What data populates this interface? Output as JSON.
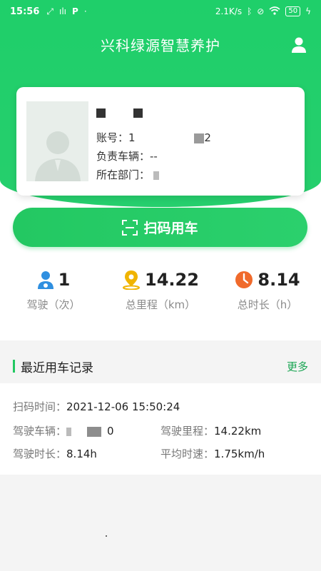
{
  "status_bar": {
    "time": "15:56",
    "net_speed": "2.1K/s",
    "battery": "50"
  },
  "header": {
    "title": "兴科绿源智慧养护"
  },
  "profile": {
    "name_masked": "",
    "account_label": "账号：",
    "account_value_start": "1",
    "account_value_end": "2",
    "vehicle_label": "负责车辆：",
    "vehicle_value": "--",
    "dept_label": "所在部门："
  },
  "scan_button": {
    "label": "扫码用车"
  },
  "stats": [
    {
      "value": "1",
      "label": "驾驶（次）",
      "icon": "driver-icon",
      "color": "#2f8fe0"
    },
    {
      "value": "14.22",
      "label": "总里程（km）",
      "icon": "location-pin-icon",
      "color": "#f0b400"
    },
    {
      "value": "8.14",
      "label": "总时长（h）",
      "icon": "clock-icon",
      "color": "#f06a2b"
    }
  ],
  "recent": {
    "title": "最近用车记录",
    "more_label": "更多",
    "scan_time_label": "扫码时间：",
    "scan_time_value": "2021-12-06 15:50:24",
    "vehicle_label": "驾驶车辆：",
    "vehicle_value_end": "0",
    "mileage_label": "驾驶里程：",
    "mileage_value": "14.22km",
    "duration_label": "驾驶时长：",
    "duration_value": "8.14h",
    "avg_speed_label": "平均时速：",
    "avg_speed_value": "1.75km/h"
  },
  "colors": {
    "brand_green": "#23c862",
    "more_link": "#1aa553"
  }
}
